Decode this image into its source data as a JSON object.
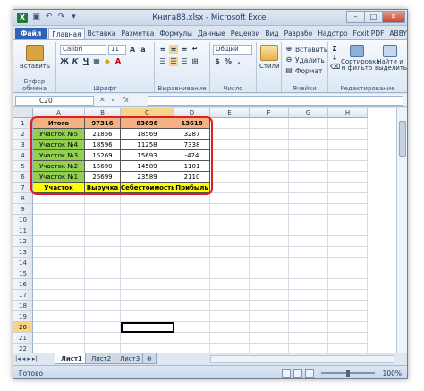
{
  "window": {
    "title": "Книга88.xlsx - Microsoft Excel",
    "app_icon": "X",
    "controls": {
      "minimize": "–",
      "maximize": "□",
      "close": "✕"
    }
  },
  "ribbon_tabs": [
    "Файл",
    "Главная",
    "Вставка",
    "Разметка",
    "Формулы",
    "Данные",
    "Рецензи",
    "Вид",
    "Разрабо",
    "Надстро",
    "Foxit PDF",
    "ABBYY PC"
  ],
  "ribbon": {
    "clipboard": {
      "paste": "Вставить",
      "label": "Буфер обмена"
    },
    "font": {
      "name": "Calibri",
      "size": "11",
      "bold": "Ж",
      "italic": "К",
      "underline": "Ч",
      "label": "Шрифт"
    },
    "alignment": {
      "label": "Выравнивание"
    },
    "number": {
      "format": "Общий",
      "label": "Число"
    },
    "styles": {
      "label": "Стили"
    },
    "cells": {
      "insert": "Вставить",
      "delete": "Удалить",
      "format": "Формат",
      "label": "Ячейки"
    },
    "editing": {
      "sort": "Сортировка и фильтр",
      "find": "Найти и выделить",
      "label": "Редактирование"
    }
  },
  "formula_bar": {
    "name_box": "C20",
    "fx": "fx",
    "value": ""
  },
  "columns": [
    "A",
    "B",
    "C",
    "D",
    "E",
    "F",
    "G",
    "H"
  ],
  "rows": [
    "1",
    "2",
    "3",
    "4",
    "5",
    "6",
    "7",
    "8",
    "9",
    "10",
    "11",
    "12",
    "13",
    "14",
    "15",
    "16",
    "17",
    "18",
    "19",
    "20",
    "21",
    "22"
  ],
  "table": [
    [
      "Итого",
      "97316",
      "83698",
      "13618"
    ],
    [
      "Участок №5",
      "21856",
      "18569",
      "3287"
    ],
    [
      "Участок №4",
      "18596",
      "11258",
      "7338"
    ],
    [
      "Участок №3",
      "15269",
      "15693",
      "-424"
    ],
    [
      "Участок №2",
      "15690",
      "14589",
      "1101"
    ],
    [
      "Участок №1",
      "25699",
      "23589",
      "2110"
    ],
    [
      "Участок",
      "Выручка",
      "Себестоимость",
      "Прибыль"
    ]
  ],
  "colors": {
    "orange": "#f4b183",
    "green": "#92d050",
    "yellow": "#ffff00",
    "red_border": "#e02020"
  },
  "sheets": [
    "Лист1",
    "Лист2",
    "Лист3"
  ],
  "status": {
    "ready": "Готово",
    "zoom": "100%"
  }
}
